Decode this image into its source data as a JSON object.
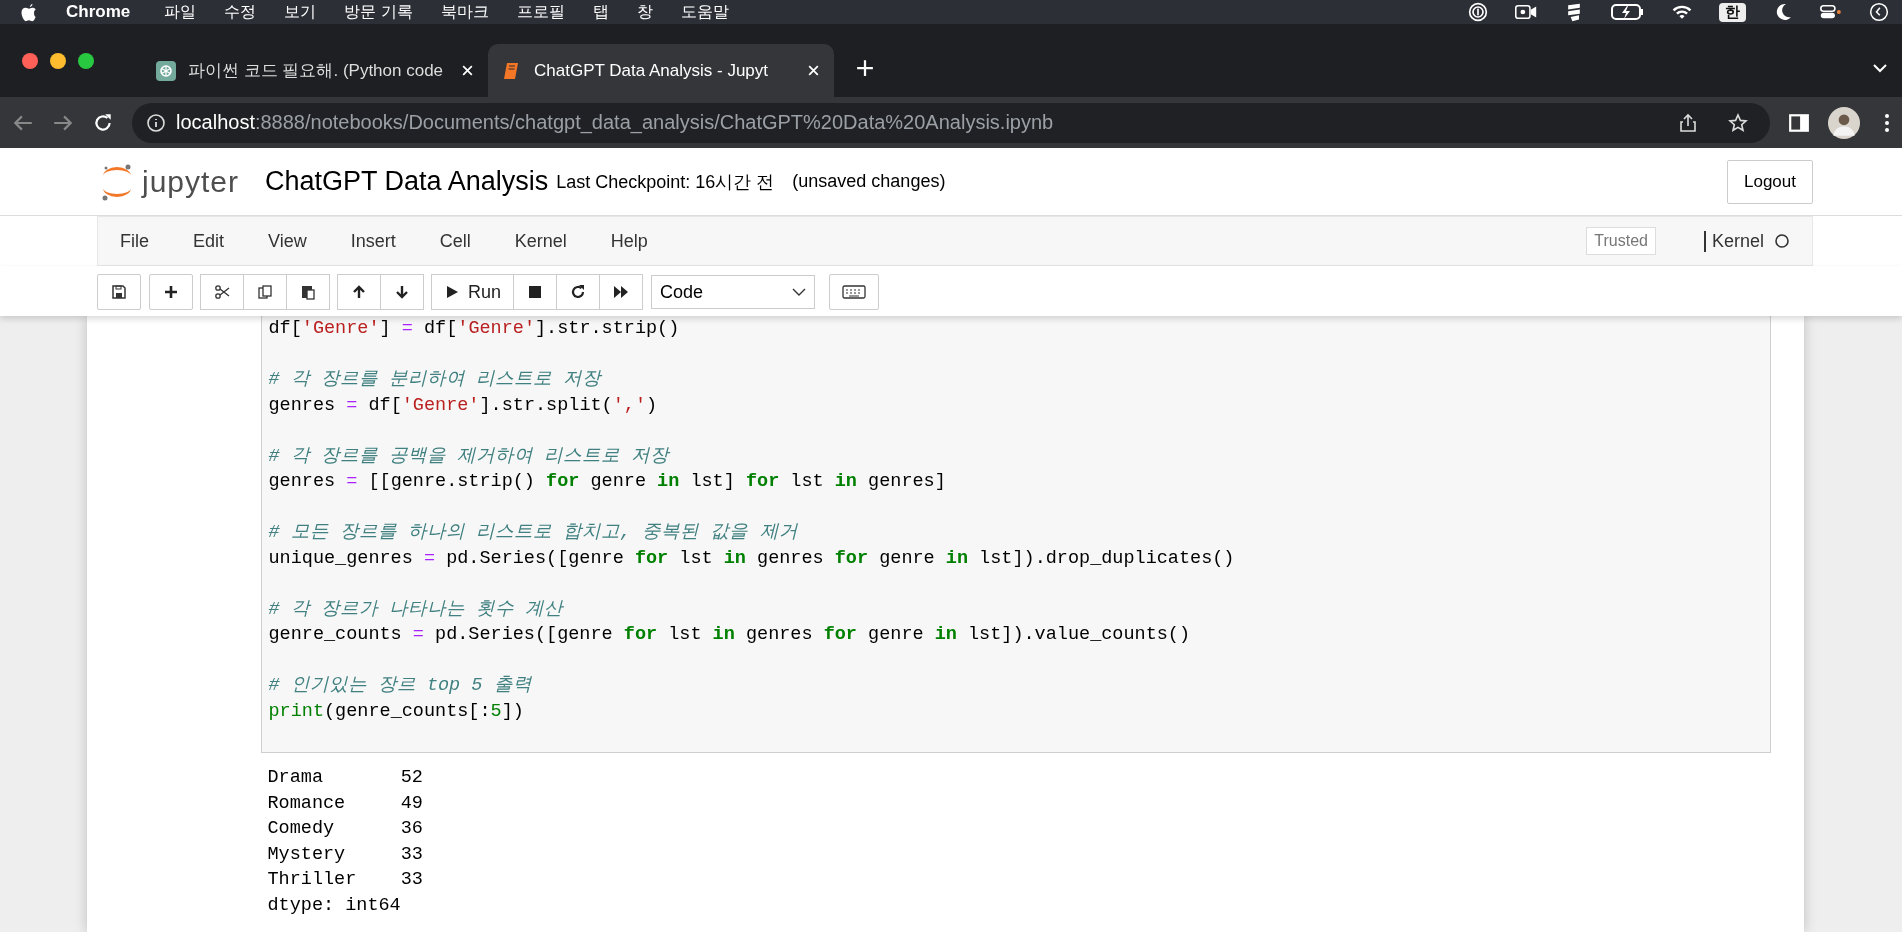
{
  "mac_menu_bar": {
    "app": "Chrome",
    "items": [
      "파일",
      "수정",
      "보기",
      "방문 기록",
      "북마크",
      "프로필",
      "탭",
      "창",
      "도움말"
    ],
    "input_source": "한"
  },
  "browser": {
    "tabs": [
      {
        "title": "파이썬 코드 필요해. (Python code",
        "selected": false,
        "kind": "chat"
      },
      {
        "title": "ChatGPT Data Analysis - Jupyt",
        "selected": true,
        "kind": "notebook"
      }
    ],
    "url_host": "localhost",
    "url_rest": ":8888/notebooks/Documents/chatgpt_data_analysis/ChatGPT%20Data%20Analysis.ipynb"
  },
  "notebook": {
    "logo_text": "jupyter",
    "title": "ChatGPT Data Analysis",
    "checkpoint": "Last Checkpoint: 16시간 전",
    "save_status": "(unsaved changes)",
    "logout": "Logout",
    "menus": [
      "File",
      "Edit",
      "View",
      "Insert",
      "Cell",
      "Kernel",
      "Help"
    ],
    "trusted": "Trusted",
    "kernel": "Kernel",
    "run_label": "Run",
    "cell_type": "Code"
  },
  "cell": {
    "code": [
      [
        [
          {
            "kind": "plain",
            "text": "df["
          },
          {
            "kind": "string",
            "text": "'Genre'"
          },
          {
            "kind": "plain",
            "text": "] "
          },
          {
            "kind": "op",
            "text": "="
          },
          {
            "kind": "plain",
            "text": " df["
          },
          {
            "kind": "string",
            "text": "'Genre'"
          },
          {
            "kind": "plain",
            "text": "].str.strip()"
          }
        ]
      ],
      [
        [
          {
            "kind": "comment",
            "text": "# 각 장르를 분리하여 리스트로 저장"
          }
        ],
        [
          {
            "kind": "plain",
            "text": "genres "
          },
          {
            "kind": "op",
            "text": "="
          },
          {
            "kind": "plain",
            "text": " df["
          },
          {
            "kind": "string",
            "text": "'Genre'"
          },
          {
            "kind": "plain",
            "text": "].str.split("
          },
          {
            "kind": "string",
            "text": "','"
          },
          {
            "kind": "plain",
            "text": ")"
          }
        ]
      ],
      [
        [
          {
            "kind": "comment",
            "text": "# 각 장르를 공백을 제거하여 리스트로 저장"
          }
        ],
        [
          {
            "kind": "plain",
            "text": "genres "
          },
          {
            "kind": "op",
            "text": "="
          },
          {
            "kind": "plain",
            "text": " [[genre.strip() "
          },
          {
            "kind": "keyword",
            "text": "for"
          },
          {
            "kind": "plain",
            "text": " genre "
          },
          {
            "kind": "keyword",
            "text": "in"
          },
          {
            "kind": "plain",
            "text": " lst] "
          },
          {
            "kind": "keyword",
            "text": "for"
          },
          {
            "kind": "plain",
            "text": " lst "
          },
          {
            "kind": "keyword",
            "text": "in"
          },
          {
            "kind": "plain",
            "text": " genres]"
          }
        ]
      ],
      [
        [
          {
            "kind": "comment",
            "text": "# 모든 장르를 하나의 리스트로 합치고, 중복된 값을 제거"
          }
        ],
        [
          {
            "kind": "plain",
            "text": "unique_genres "
          },
          {
            "kind": "op",
            "text": "="
          },
          {
            "kind": "plain",
            "text": " pd.Series([genre "
          },
          {
            "kind": "keyword",
            "text": "for"
          },
          {
            "kind": "plain",
            "text": " lst "
          },
          {
            "kind": "keyword",
            "text": "in"
          },
          {
            "kind": "plain",
            "text": " genres "
          },
          {
            "kind": "keyword",
            "text": "for"
          },
          {
            "kind": "plain",
            "text": " genre "
          },
          {
            "kind": "keyword",
            "text": "in"
          },
          {
            "kind": "plain",
            "text": " lst]).drop_duplicates()"
          }
        ]
      ],
      [
        [
          {
            "kind": "comment",
            "text": "# 각 장르가 나타나는 횟수 계산"
          }
        ],
        [
          {
            "kind": "plain",
            "text": "genre_counts "
          },
          {
            "kind": "op",
            "text": "="
          },
          {
            "kind": "plain",
            "text": " pd.Series([genre "
          },
          {
            "kind": "keyword",
            "text": "for"
          },
          {
            "kind": "plain",
            "text": " lst "
          },
          {
            "kind": "keyword",
            "text": "in"
          },
          {
            "kind": "plain",
            "text": " genres "
          },
          {
            "kind": "keyword",
            "text": "for"
          },
          {
            "kind": "plain",
            "text": " genre "
          },
          {
            "kind": "keyword",
            "text": "in"
          },
          {
            "kind": "plain",
            "text": " lst]).value_counts()"
          }
        ]
      ],
      [
        [
          {
            "kind": "comment",
            "text": "# 인기있는 장르 top 5 출력"
          }
        ],
        [
          {
            "kind": "builtin",
            "text": "print"
          },
          {
            "kind": "plain",
            "text": "(genre_counts[:"
          },
          {
            "kind": "number",
            "text": "5"
          },
          {
            "kind": "plain",
            "text": "])"
          }
        ]
      ]
    ],
    "output": [
      "Drama       52",
      "Romance     49",
      "Comedy      36",
      "Mystery     33",
      "Thriller    33",
      "dtype: int64"
    ]
  }
}
